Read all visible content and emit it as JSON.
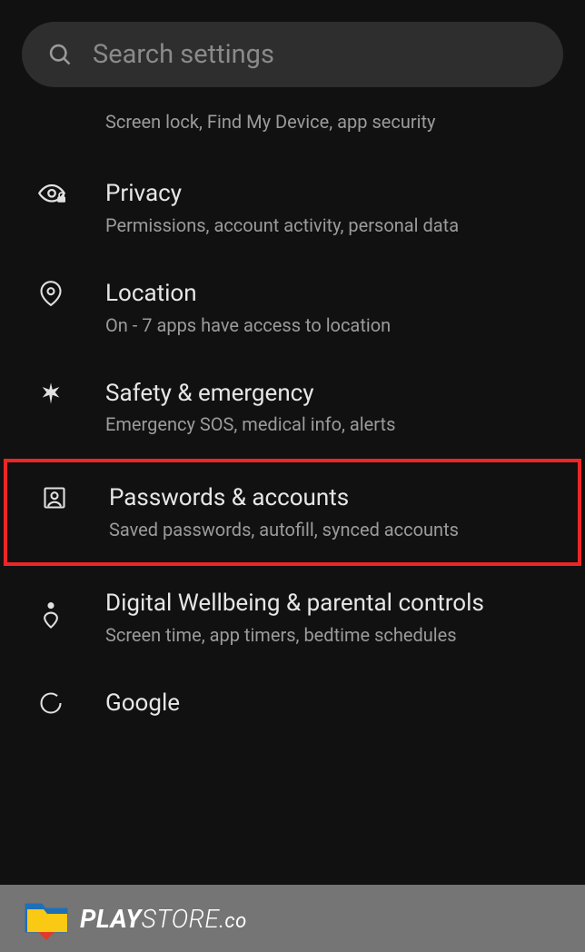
{
  "search": {
    "placeholder": "Search settings"
  },
  "partialTop": {
    "subtitle": "Screen lock, Find My Device, app security"
  },
  "items": [
    {
      "title": "Privacy",
      "subtitle": "Permissions, account activity, personal data"
    },
    {
      "title": "Location",
      "subtitle": "On - 7 apps have access to location"
    },
    {
      "title": "Safety & emergency",
      "subtitle": "Emergency SOS, medical info, alerts"
    },
    {
      "title": "Passwords & accounts",
      "subtitle": "Saved passwords, autofill, synced accounts"
    },
    {
      "title": "Digital Wellbeing & parental controls",
      "subtitle": "Screen time, app timers, bedtime schedules"
    }
  ],
  "partialBottom": {
    "title": "Google"
  },
  "footer": {
    "brand_bold": "PLAY",
    "brand_light": "STORE",
    "brand_suffix": ".co"
  }
}
